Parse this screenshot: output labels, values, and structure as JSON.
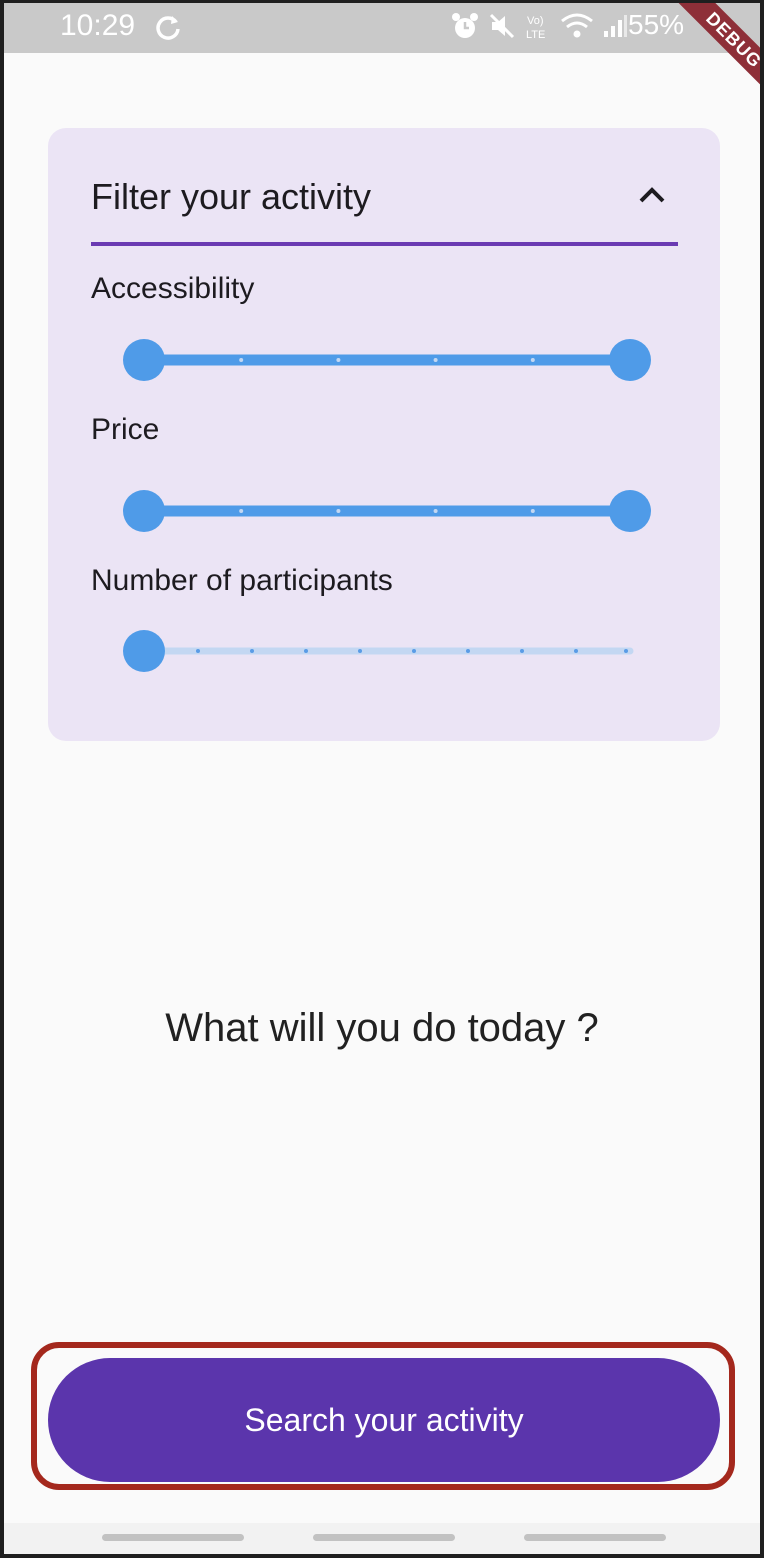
{
  "status_bar": {
    "time": "10:29",
    "battery": "55%",
    "icons": [
      "sync-icon",
      "alarm-icon",
      "mute-icon",
      "volte-icon",
      "wifi-icon",
      "signal-icon"
    ]
  },
  "debug_banner": "DEBUG",
  "filter": {
    "title": "Filter your activity",
    "expanded": true,
    "sliders": [
      {
        "label": "Accessibility",
        "type": "range",
        "divisions": 5,
        "start": 0.0,
        "end": 1.0
      },
      {
        "label": "Price",
        "type": "range",
        "divisions": 5,
        "start": 0.0,
        "end": 1.0
      },
      {
        "label": "Number of participants",
        "type": "single",
        "divisions": 9,
        "value": 0.0
      }
    ]
  },
  "headline": "What will you do today ?",
  "search_button": {
    "label": "Search your activity"
  },
  "colors": {
    "accent": "#5b35ac",
    "slider_active": "#4f9be8",
    "slider_inactive": "#c3d7f2",
    "card_bg": "#ebe4f5",
    "highlight": "#a4281d"
  }
}
